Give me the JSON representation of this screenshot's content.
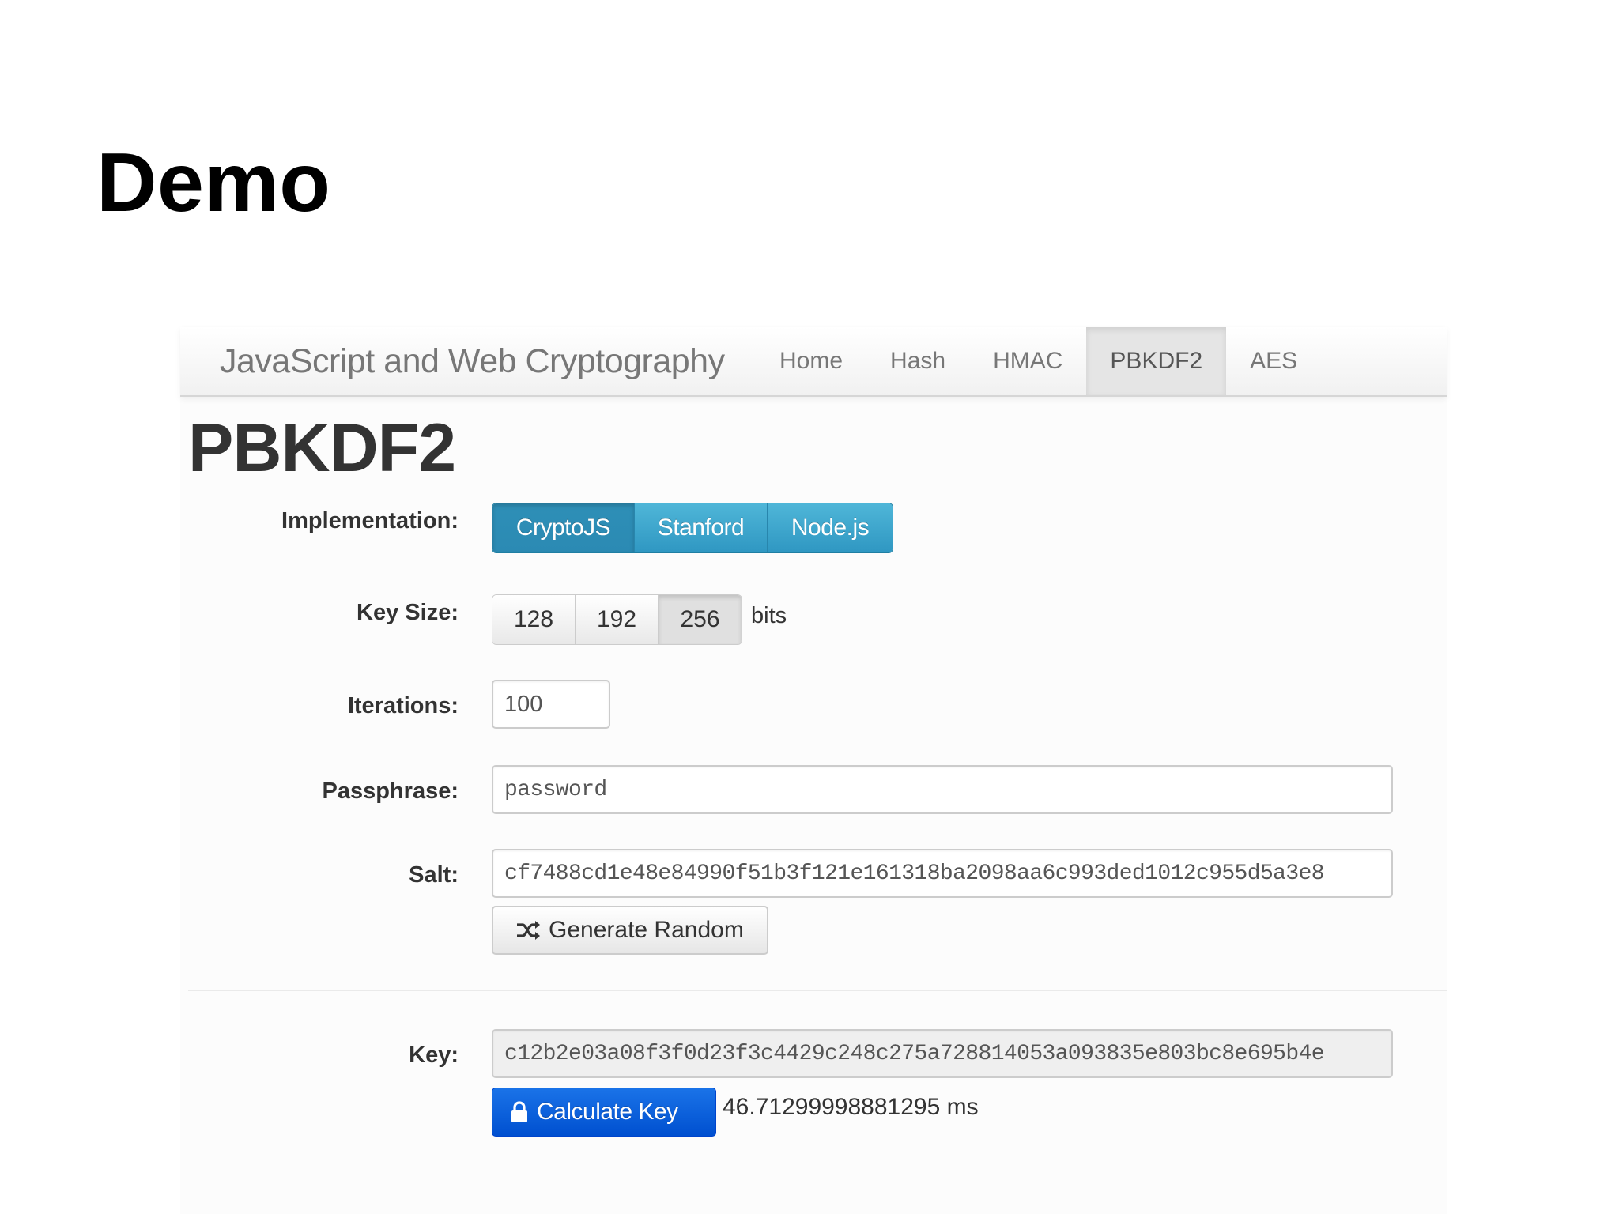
{
  "slide": {
    "title": "Demo"
  },
  "navbar": {
    "brand": "JavaScript and Web Cryptography",
    "items": [
      {
        "label": "Home",
        "active": false
      },
      {
        "label": "Hash",
        "active": false
      },
      {
        "label": "HMAC",
        "active": false
      },
      {
        "label": "PBKDF2",
        "active": true
      },
      {
        "label": "AES",
        "active": false
      }
    ]
  },
  "page": {
    "title": "PBKDF2"
  },
  "form": {
    "implementation": {
      "label": "Implementation:",
      "options": [
        "CryptoJS",
        "Stanford",
        "Node.js"
      ],
      "selected": "CryptoJS"
    },
    "key_size": {
      "label": "Key Size:",
      "options": [
        "128",
        "192",
        "256"
      ],
      "selected": "256",
      "units": "bits"
    },
    "iterations": {
      "label": "Iterations:",
      "value": "100"
    },
    "passphrase": {
      "label": "Passphrase:",
      "value": "password"
    },
    "salt": {
      "label": "Salt:",
      "value": "cf7488cd1e48e84990f51b3f121e161318ba2098aa6c993ded1012c955d5a3e8",
      "generate_label": "Generate Random",
      "generate_icon": "shuffle-icon"
    },
    "key": {
      "label": "Key:",
      "value": "c12b2e03a08f3f0d23f3c4429c248c275a728814053a093835e803bc8e695b4e",
      "calculate_label": "Calculate Key",
      "calculate_icon": "lock-icon",
      "elapsed": "46.71299998881295 ms"
    }
  },
  "colors": {
    "info_button": "#2f97c2",
    "primary_button": "#0050d0",
    "navbar_active": "#e5e5e5"
  }
}
